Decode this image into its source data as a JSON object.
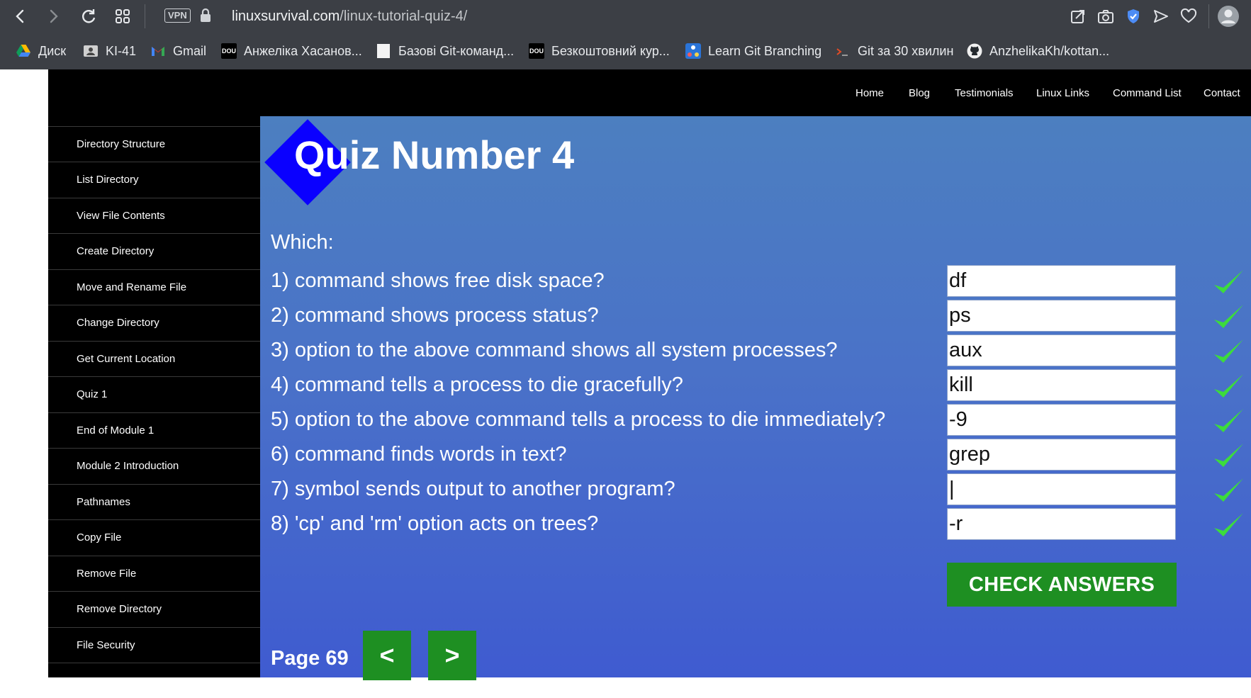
{
  "browser": {
    "vpn_label": "VPN",
    "url_host": "linuxsurvival.com",
    "url_path": "/linux-tutorial-quiz-4/",
    "bookmarks": [
      {
        "label": "Диск",
        "icon": "google-drive-icon"
      },
      {
        "label": "KI-41",
        "icon": "classroom-icon"
      },
      {
        "label": "Gmail",
        "icon": "gmail-icon"
      },
      {
        "label": "Анжеліка Хасанов...",
        "icon": "dou-icon"
      },
      {
        "label": "Базові Git-команд...",
        "icon": "page-icon"
      },
      {
        "label": "Безкоштовний кур...",
        "icon": "dou-icon"
      },
      {
        "label": "Learn Git Branching",
        "icon": "git-branching-icon"
      },
      {
        "label": "Git за 30 хвилин",
        "icon": "terminal-icon"
      },
      {
        "label": "AnzhelikaKh/kottan...",
        "icon": "github-icon"
      }
    ],
    "dou_text": "DOU"
  },
  "site": {
    "top_nav": [
      "Home",
      "Blog",
      "Testimonials",
      "Linux Links",
      "Command List",
      "Contact"
    ],
    "sidebar": [
      "Directory Structure",
      "List Directory",
      "View File Contents",
      "Create Directory",
      "Move and Rename File",
      "Change Directory",
      "Get Current Location",
      "Quiz 1",
      "End of Module 1",
      "Module 2 Introduction",
      "Pathnames",
      "Copy File",
      "Remove File",
      "Remove Directory",
      "File Security"
    ]
  },
  "quiz": {
    "title": "Quiz Number 4",
    "intro": "Which:",
    "questions": [
      {
        "text": "1) command shows free disk space?",
        "answer": "df",
        "correct": true
      },
      {
        "text": "2) command shows process status?",
        "answer": "ps",
        "correct": true
      },
      {
        "text": "3) option to the above command shows all system processes?",
        "answer": "aux",
        "correct": true
      },
      {
        "text": "4) command tells a process to die gracefully?",
        "answer": "kill",
        "correct": true
      },
      {
        "text": "5) option to the above command tells a process to die immediately?",
        "answer": "-9",
        "correct": true
      },
      {
        "text": "6) command finds words in text?",
        "answer": "grep",
        "correct": true
      },
      {
        "text": "7) symbol sends output to another program?",
        "answer": "|",
        "correct": true
      },
      {
        "text": "8) 'cp' and 'rm' option acts on trees?",
        "answer": "-r",
        "correct": true
      }
    ],
    "check_button": "CHECK ANSWERS",
    "page_label": "Page 69",
    "prev_label": "<",
    "next_label": ">"
  },
  "colors": {
    "accent_green": "#1e8f22",
    "check_green": "#3cdc3c",
    "diamond_blue": "#0a00ff"
  }
}
